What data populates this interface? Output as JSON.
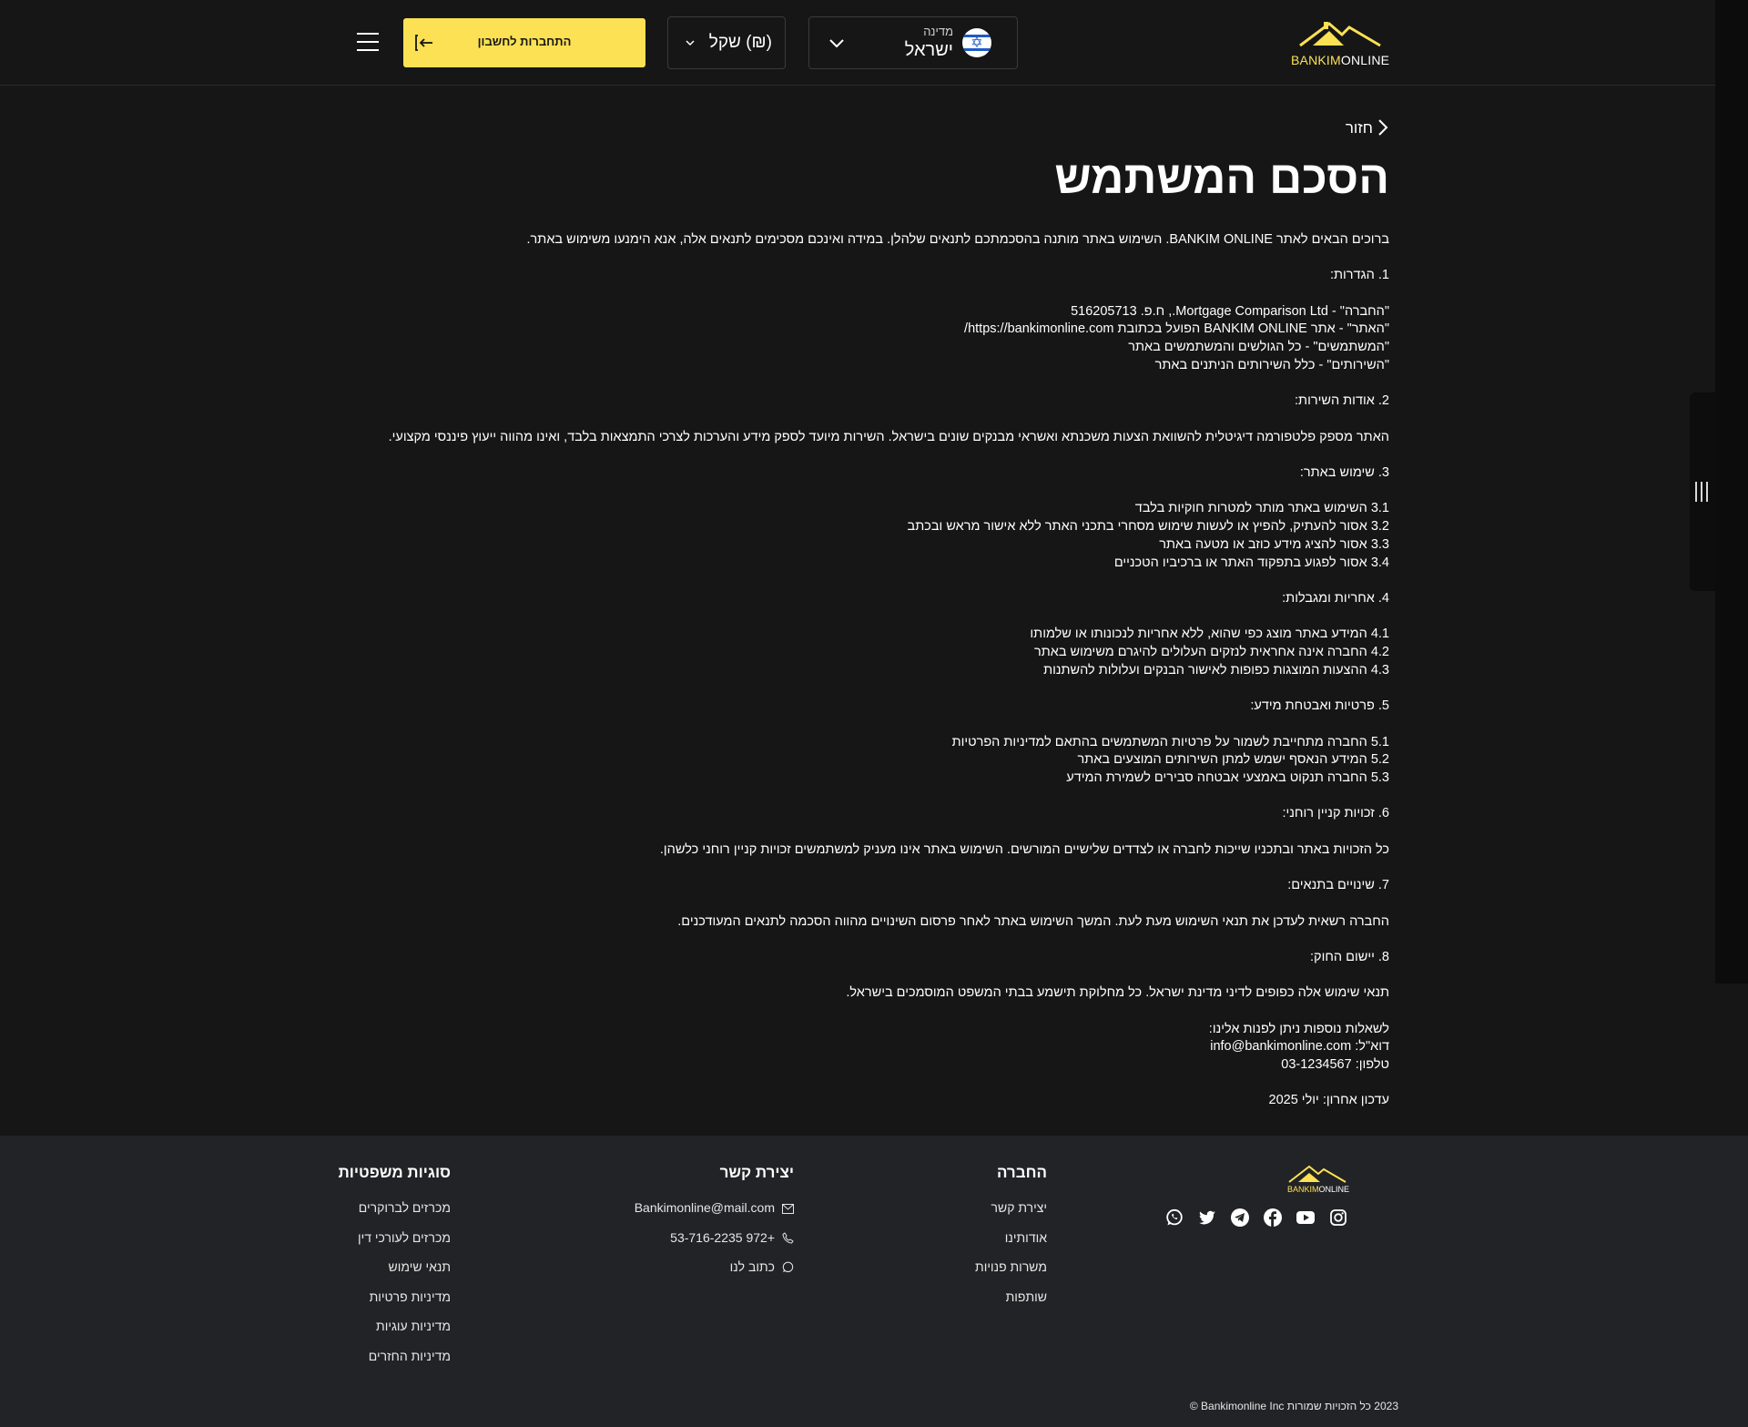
{
  "header": {
    "logo": {
      "part1": "BANKIM",
      "part2": "ONLINE"
    },
    "country": {
      "label": "מדינה",
      "value": "ישראל"
    },
    "currency": {
      "value": "(₪) שקל"
    },
    "login_label": "התחברות לחשבון"
  },
  "main": {
    "back_label": "חזור",
    "title": "הסכם המשתמש",
    "paragraphs": [
      "ברוכים הבאים לאתר BANKIM ONLINE. השימוש באתר מותנה בהסכמתכם לתנאים שלהלן. במידה ואינכם מסכימים לתנאים אלה, אנא הימנעו משימוש באתר.",
      "",
      "1. הגדרות:",
      "",
      "\"החברה\" - Mortgage Comparison Ltd., ח.פ. 516205713",
      "\"האתר\" - אתר BANKIM ONLINE הפועל בכתובת https://bankimonline.com/",
      "\"המשתמשים\" - כל הגולשים והמשתמשים באתר",
      "\"השירותים\" - כלל השירותים הניתנים באתר",
      "",
      "2. אודות השירות:",
      "",
      "האתר מספק פלטפורמה דיגיטלית להשוואת הצעות משכנתא ואשראי מבנקים שונים בישראל. השירות מיועד לספק מידע והערכות לצרכי התמצאות בלבד, ואינו מהווה ייעוץ פיננסי מקצועי.",
      "",
      "3. שימוש באתר:",
      "",
      "3.1 השימוש באתר מותר למטרות חוקיות בלבד",
      "3.2 אסור להעתיק, להפיץ או לעשות שימוש מסחרי בתכני האתר ללא אישור מראש ובכתב",
      "3.3 אסור להציג מידע כוזב או מטעה באתר",
      "3.4 אסור לפגוע בתפקוד האתר או ברכיביו הטכניים",
      "",
      "4. אחריות ומגבלות:",
      "",
      "4.1 המידע באתר מוצג כפי שהוא, ללא אחריות לנכונותו או שלמותו",
      "4.2 החברה אינה אחראית לנזקים העלולים להיגרם משימוש באתר",
      "4.3 ההצעות המוצגות כפופות לאישור הבנקים ועלולות להשתנות",
      "",
      "5. פרטיות ואבטחת מידע:",
      "",
      "5.1 החברה מתחייבת לשמור על פרטיות המשתמשים בהתאם למדיניות הפרטיות",
      "5.2 המידע הנאסף ישמש למתן השירותים המוצעים באתר",
      "5.3 החברה תנקוט באמצעי אבטחה סבירים לשמירת המידע",
      "",
      "6. זכויות קניין רוחני:",
      "",
      "כל הזכויות באתר ובתכניו שייכות לחברה או לצדדים שלישיים המורשים. השימוש באתר אינו מעניק למשתמשים זכויות קניין רוחני כלשהן.",
      "",
      "7. שינויים בתנאים:",
      "",
      "החברה רשאית לעדכן את תנאי השימוש מעת לעת. המשך השימוש באתר לאחר פרסום השינויים מהווה הסכמה לתנאים המעודכנים.",
      "",
      "8. יישום החוק:",
      "",
      "תנאי שימוש אלה כפופים לדיני מדינת ישראל. כל מחלוקת תישמע בבתי המשפט המוסמכים בישראל.",
      "",
      "לשאלות נוספות ניתן לפנות אלינו:",
      "דוא\"ל: info@bankimonline.com",
      "טלפון: 03-1234567",
      "",
      "עדכון אחרון: יולי 2025"
    ]
  },
  "footer": {
    "logo": {
      "part1": "BANKIM",
      "part2": "ONLINE"
    },
    "socials": [
      "instagram-icon",
      "youtube-icon",
      "facebook-icon",
      "telegram-icon",
      "twitter-icon",
      "whatsapp-icon"
    ],
    "company": {
      "title": "החברה",
      "links": [
        "יצירת קשר",
        "אודותינו",
        "משרות פנויות",
        "שותפות"
      ]
    },
    "contact": {
      "title": "יצירת קשר",
      "email": "Bankimonline@mail.com",
      "phone": "+972 53-716-2235",
      "write": "כתוב לנו"
    },
    "legal": {
      "title": "סוגיות משפטיות",
      "links": [
        "מכרזים לברוקרים",
        "מכרזים לעורכי דין",
        "תנאי שימוש",
        "מדיניות פרטיות",
        "מדיניות עוגיות",
        "מדיניות החזרים"
      ]
    },
    "copyright": "2023 כל הזכויות שמורות Bankimonline Inc ©"
  },
  "colors": {
    "accent": "#fbe153",
    "background": "#161616",
    "footer": "#222326"
  }
}
